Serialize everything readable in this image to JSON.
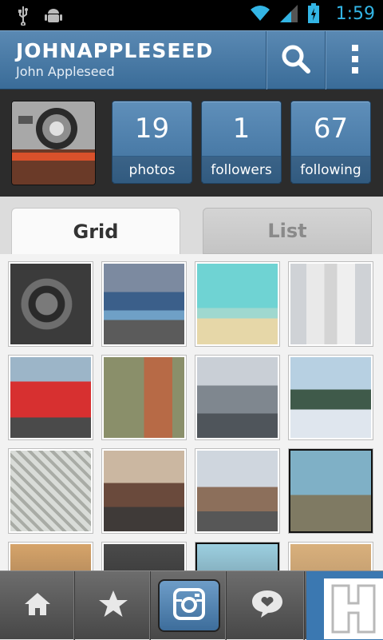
{
  "status_bar": {
    "time": "1:59",
    "icons": [
      "usb-icon",
      "android-icon",
      "wifi-icon",
      "signal-icon",
      "battery-icon"
    ]
  },
  "action_bar": {
    "username": "JOHNAPPLESEED",
    "full_name": "John Appleseed",
    "icons": [
      "search-icon",
      "overflow-menu-icon"
    ]
  },
  "profile": {
    "stats": [
      {
        "value": "19",
        "label": "photos"
      },
      {
        "value": "1",
        "label": "followers"
      },
      {
        "value": "67",
        "label": "following"
      }
    ]
  },
  "tabs": {
    "grid": "Grid",
    "list": "List",
    "selected": "Grid"
  },
  "bottom_nav": {
    "icons": [
      "home-icon",
      "star-icon",
      "camera-icon",
      "news-heart-icon"
    ]
  },
  "colors": {
    "accent": "#3d6f9c",
    "status_blue": "#33b5e5"
  }
}
